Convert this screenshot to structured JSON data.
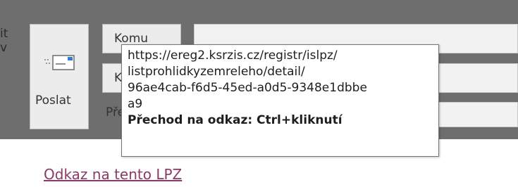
{
  "left_edge": {
    "chars": "it\nv"
  },
  "send_button": {
    "label": "Poslat",
    "icon": "envelope-send-icon"
  },
  "fields": {
    "to_label": "Komu",
    "cc_label": "K",
    "subject_label": "Pře"
  },
  "tooltip": {
    "url_lines": [
      "https://ereg2.ksrzis.cz/registr/islpz/",
      "listprohlidkyzemreleho/detail/",
      "96ae4cab-f6d5-45ed-a0d5-9348e1dbbe",
      "a9"
    ],
    "hint": "Přechod na odkaz: Ctrl+kliknutí"
  },
  "body": {
    "link_text": "Odkaz na tento LPZ"
  },
  "colors": {
    "link": "#8a3b65",
    "chrome_gray": "#6e6e6e"
  }
}
